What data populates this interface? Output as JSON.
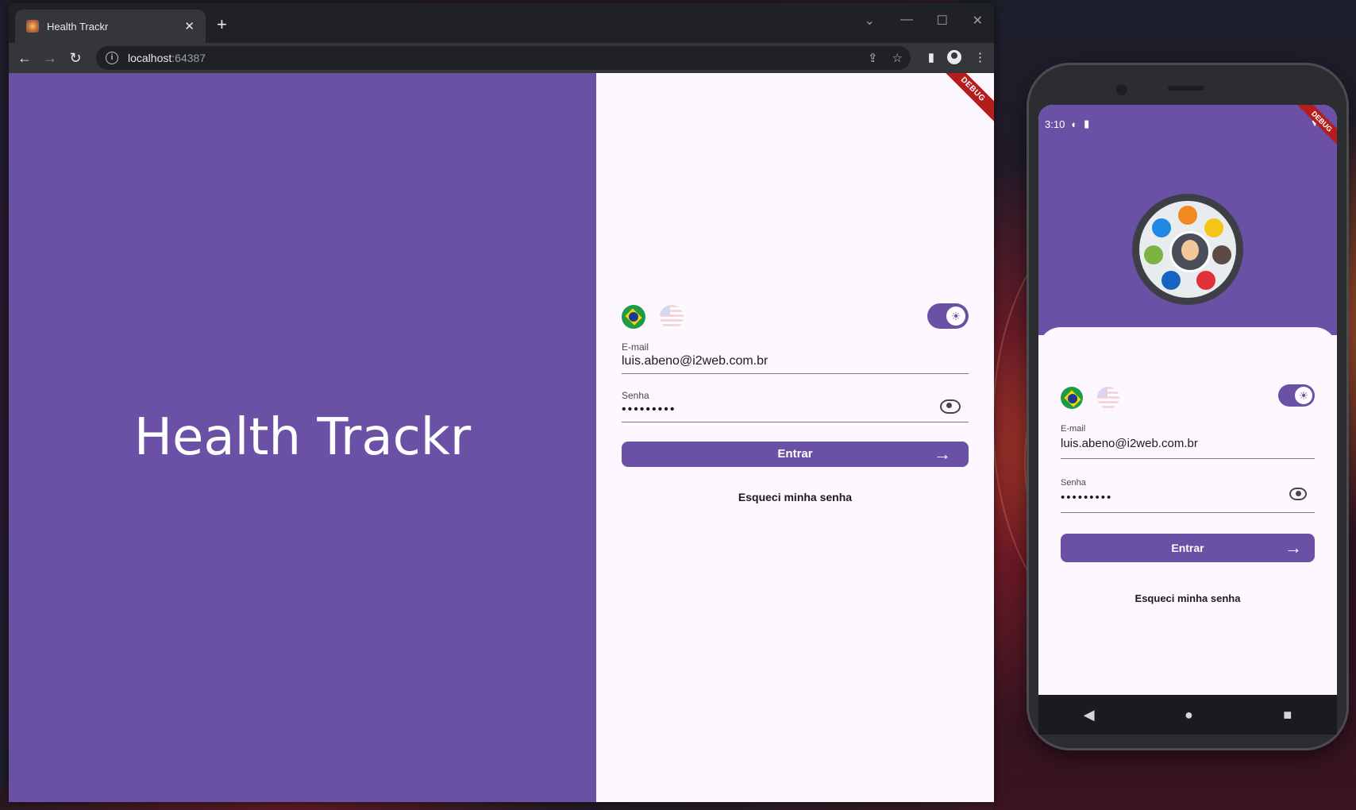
{
  "browser": {
    "tab_title": "Health Trackr",
    "tab_close": "✕",
    "new_tab": "+",
    "url_host": "localhost",
    "url_port": ":64387"
  },
  "app": {
    "brand_title": "Health Trackr",
    "debug_label": "DEBUG",
    "email_label": "E-mail",
    "email_value": "luis.abeno@i2web.com.br",
    "password_label": "Senha",
    "password_value": "•••••••••",
    "login_button": "Entrar",
    "forgot_link": "Esqueci minha senha"
  },
  "phone": {
    "time": "3:10",
    "debug_label": "DEBUG"
  },
  "colors": {
    "primary": "#6a51a6",
    "surface": "#fdf7ff",
    "debug": "#b71c1c"
  },
  "icons": [
    "back-icon",
    "forward-icon",
    "reload-icon",
    "info-icon",
    "share-icon",
    "star-icon",
    "sidepanel-icon",
    "profile-icon",
    "menu-icon",
    "sun-icon",
    "eye-icon",
    "arrow-right-icon"
  ]
}
